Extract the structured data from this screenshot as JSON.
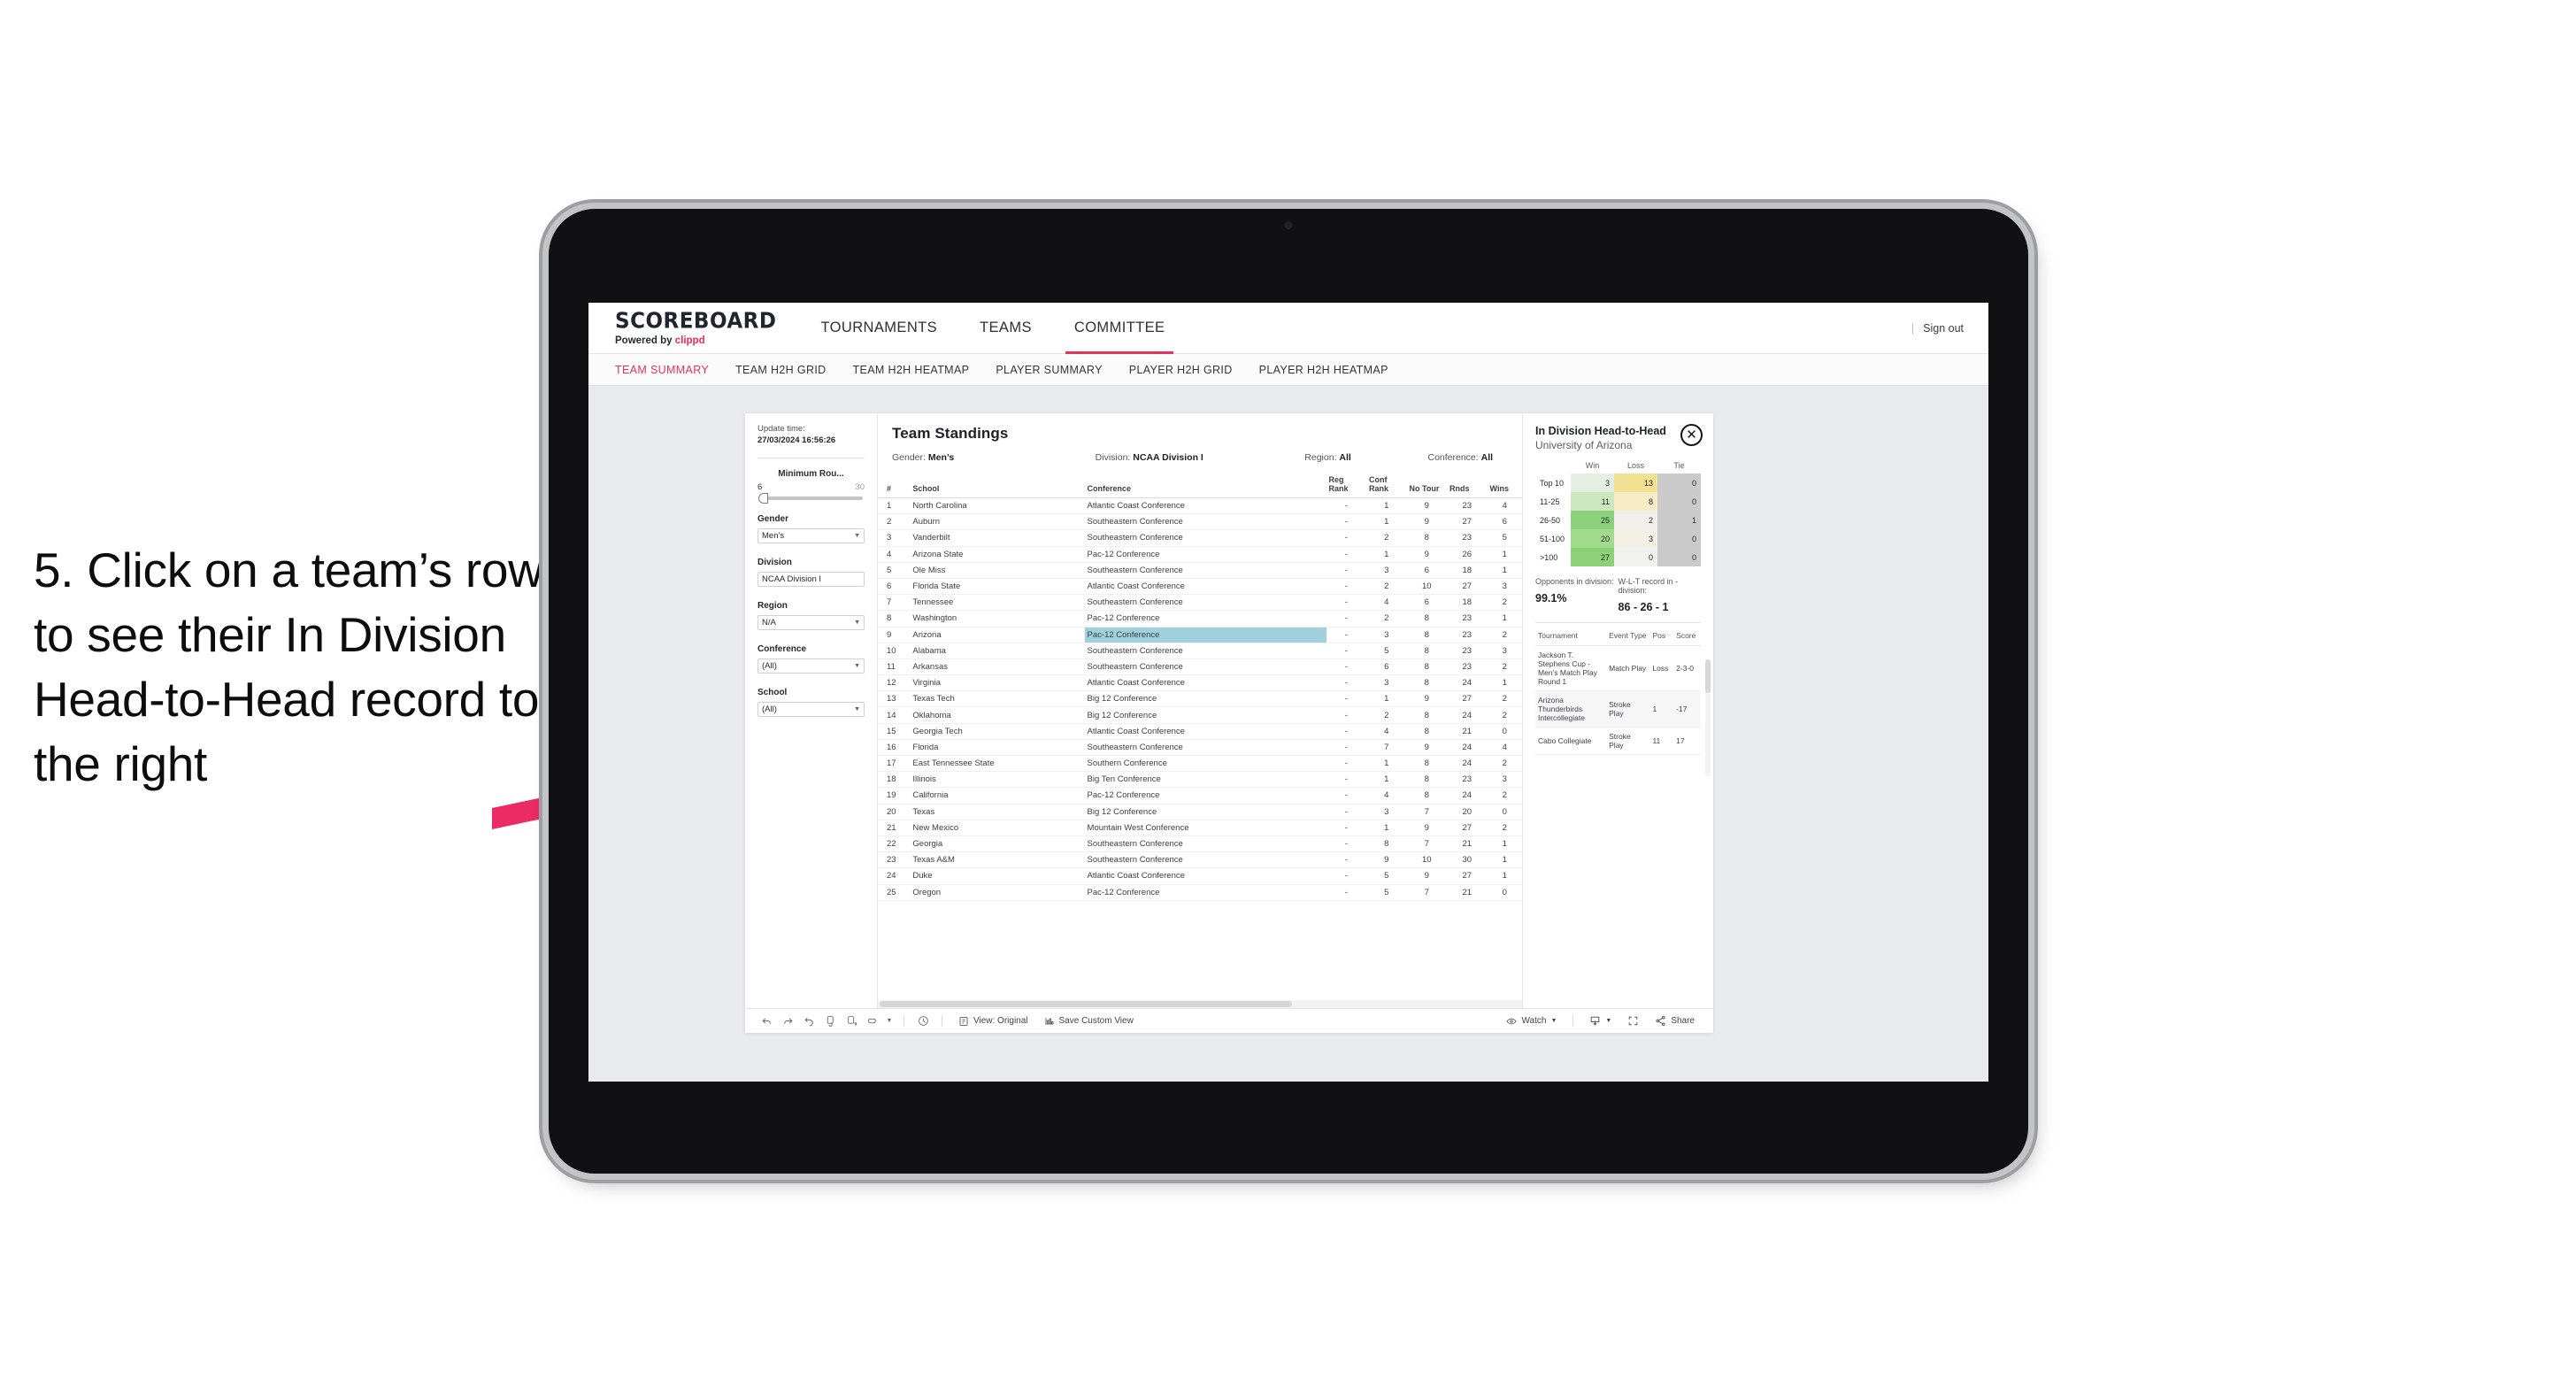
{
  "annotation": {
    "text": "5. Click on a team’s row to see their In Division Head-to-Head record to the right",
    "arrow_color": "#ec2a63"
  },
  "header": {
    "brand_name": "SCOREBOARD",
    "brand_sub_prefix": "Powered by ",
    "brand_sub_accent": "clippd",
    "nav": [
      {
        "label": "TOURNAMENTS",
        "active": false
      },
      {
        "label": "TEAMS",
        "active": false
      },
      {
        "label": "COMMITTEE",
        "active": true
      }
    ],
    "separator": "|",
    "sign_out": "Sign out",
    "accent_color": "#e8315b"
  },
  "subnav": [
    {
      "label": "TEAM SUMMARY",
      "active": true
    },
    {
      "label": "TEAM H2H GRID",
      "active": false
    },
    {
      "label": "TEAM H2H HEATMAP",
      "active": false
    },
    {
      "label": "PLAYER SUMMARY",
      "active": false
    },
    {
      "label": "PLAYER H2H GRID",
      "active": false
    },
    {
      "label": "PLAYER H2H HEATMAP",
      "active": false
    }
  ],
  "sidebar": {
    "update_label": "Update time:",
    "update_value": "27/03/2024 16:56:26",
    "slider": {
      "title": "Minimum Rou...",
      "min": "6",
      "max": "30"
    },
    "filters": [
      {
        "title": "Gender",
        "value": "Men’s"
      },
      {
        "title": "Division",
        "value": "NCAA Division I"
      },
      {
        "title": "Region",
        "value": "N/A"
      },
      {
        "title": "Conference",
        "value": "(All)"
      },
      {
        "title": "School",
        "value": "(All)"
      }
    ]
  },
  "standings": {
    "title": "Team Standings",
    "crumbs": {
      "gender_label": "Gender:",
      "gender_value": "Men’s",
      "division_label": "Division:",
      "division_value": "NCAA Division I",
      "region_label": "Region:",
      "region_value": "All",
      "conference_label": "Conference:",
      "conference_value": "All"
    },
    "columns": [
      "#",
      "School",
      "Conference",
      "Reg Rank",
      "Conf Rank",
      "No Tour",
      "Rnds",
      "Wins"
    ],
    "rows": [
      {
        "n": "1",
        "school": "North Carolina",
        "conf": "Atlantic Coast Conference",
        "reg": "-",
        "cr": "1",
        "nt": "9",
        "rnds": "23",
        "wins": "4",
        "selected": false
      },
      {
        "n": "2",
        "school": "Auburn",
        "conf": "Southeastern Conference",
        "reg": "-",
        "cr": "1",
        "nt": "9",
        "rnds": "27",
        "wins": "6",
        "selected": false
      },
      {
        "n": "3",
        "school": "Vanderbilt",
        "conf": "Southeastern Conference",
        "reg": "-",
        "cr": "2",
        "nt": "8",
        "rnds": "23",
        "wins": "5",
        "selected": false
      },
      {
        "n": "4",
        "school": "Arizona State",
        "conf": "Pac-12 Conference",
        "reg": "-",
        "cr": "1",
        "nt": "9",
        "rnds": "26",
        "wins": "1",
        "selected": false
      },
      {
        "n": "5",
        "school": "Ole Miss",
        "conf": "Southeastern Conference",
        "reg": "-",
        "cr": "3",
        "nt": "6",
        "rnds": "18",
        "wins": "1",
        "selected": false
      },
      {
        "n": "6",
        "school": "Florida State",
        "conf": "Atlantic Coast Conference",
        "reg": "-",
        "cr": "2",
        "nt": "10",
        "rnds": "27",
        "wins": "3",
        "selected": false
      },
      {
        "n": "7",
        "school": "Tennessee",
        "conf": "Southeastern Conference",
        "reg": "-",
        "cr": "4",
        "nt": "6",
        "rnds": "18",
        "wins": "2",
        "selected": false
      },
      {
        "n": "8",
        "school": "Washington",
        "conf": "Pac-12 Conference",
        "reg": "-",
        "cr": "2",
        "nt": "8",
        "rnds": "23",
        "wins": "1",
        "selected": false
      },
      {
        "n": "9",
        "school": "Arizona",
        "conf": "Pac-12 Conference",
        "reg": "-",
        "cr": "3",
        "nt": "8",
        "rnds": "23",
        "wins": "2",
        "selected": true
      },
      {
        "n": "10",
        "school": "Alabama",
        "conf": "Southeastern Conference",
        "reg": "-",
        "cr": "5",
        "nt": "8",
        "rnds": "23",
        "wins": "3",
        "selected": false
      },
      {
        "n": "11",
        "school": "Arkansas",
        "conf": "Southeastern Conference",
        "reg": "-",
        "cr": "6",
        "nt": "8",
        "rnds": "23",
        "wins": "2",
        "selected": false
      },
      {
        "n": "12",
        "school": "Virginia",
        "conf": "Atlantic Coast Conference",
        "reg": "-",
        "cr": "3",
        "nt": "8",
        "rnds": "24",
        "wins": "1",
        "selected": false
      },
      {
        "n": "13",
        "school": "Texas Tech",
        "conf": "Big 12 Conference",
        "reg": "-",
        "cr": "1",
        "nt": "9",
        "rnds": "27",
        "wins": "2",
        "selected": false
      },
      {
        "n": "14",
        "school": "Oklahoma",
        "conf": "Big 12 Conference",
        "reg": "-",
        "cr": "2",
        "nt": "8",
        "rnds": "24",
        "wins": "2",
        "selected": false
      },
      {
        "n": "15",
        "school": "Georgia Tech",
        "conf": "Atlantic Coast Conference",
        "reg": "-",
        "cr": "4",
        "nt": "8",
        "rnds": "21",
        "wins": "0",
        "selected": false
      },
      {
        "n": "16",
        "school": "Florida",
        "conf": "Southeastern Conference",
        "reg": "-",
        "cr": "7",
        "nt": "9",
        "rnds": "24",
        "wins": "4",
        "selected": false
      },
      {
        "n": "17",
        "school": "East Tennessee State",
        "conf": "Southern Conference",
        "reg": "-",
        "cr": "1",
        "nt": "8",
        "rnds": "24",
        "wins": "2",
        "selected": false
      },
      {
        "n": "18",
        "school": "Illinois",
        "conf": "Big Ten Conference",
        "reg": "-",
        "cr": "1",
        "nt": "8",
        "rnds": "23",
        "wins": "3",
        "selected": false
      },
      {
        "n": "19",
        "school": "California",
        "conf": "Pac-12 Conference",
        "reg": "-",
        "cr": "4",
        "nt": "8",
        "rnds": "24",
        "wins": "2",
        "selected": false
      },
      {
        "n": "20",
        "school": "Texas",
        "conf": "Big 12 Conference",
        "reg": "-",
        "cr": "3",
        "nt": "7",
        "rnds": "20",
        "wins": "0",
        "selected": false
      },
      {
        "n": "21",
        "school": "New Mexico",
        "conf": "Mountain West Conference",
        "reg": "-",
        "cr": "1",
        "nt": "9",
        "rnds": "27",
        "wins": "2",
        "selected": false
      },
      {
        "n": "22",
        "school": "Georgia",
        "conf": "Southeastern Conference",
        "reg": "-",
        "cr": "8",
        "nt": "7",
        "rnds": "21",
        "wins": "1",
        "selected": false
      },
      {
        "n": "23",
        "school": "Texas A&M",
        "conf": "Southeastern Conference",
        "reg": "-",
        "cr": "9",
        "nt": "10",
        "rnds": "30",
        "wins": "1",
        "selected": false
      },
      {
        "n": "24",
        "school": "Duke",
        "conf": "Atlantic Coast Conference",
        "reg": "-",
        "cr": "5",
        "nt": "9",
        "rnds": "27",
        "wins": "1",
        "selected": false
      },
      {
        "n": "25",
        "school": "Oregon",
        "conf": "Pac-12 Conference",
        "reg": "-",
        "cr": "5",
        "nt": "7",
        "rnds": "21",
        "wins": "0",
        "selected": false
      }
    ]
  },
  "h2h": {
    "title": "In Division Head-to-Head",
    "subtitle": "University of Arizona",
    "close_icon": "close-icon",
    "stats": {
      "opponents_label": "Opponents in division:",
      "opponents_value": "99.1%",
      "record_label": "W-L-T record in -division:",
      "record_value": "86 - 26 - 1"
    },
    "tournament_columns": [
      "Tournament",
      "Event Type",
      "Pos",
      "Score"
    ],
    "tournaments": [
      {
        "name": "Jackson T. Stephens Cup - Men’s Match Play Round 1",
        "type": "Match Play",
        "pos": "Loss",
        "score": "2-3-0"
      },
      {
        "name": "Arizona Thunderbirds Intercollegiate",
        "type": "Stroke Play",
        "pos": "1",
        "score": "-17"
      },
      {
        "name": "Cabo Collegiate",
        "type": "Stroke Play",
        "pos": "11",
        "score": "17"
      }
    ]
  },
  "chart_data": {
    "type": "heatmap",
    "title": "In Division Head-to-Head",
    "subtitle": "University of Arizona",
    "columns": [
      "Win",
      "Loss",
      "Tie"
    ],
    "categories": [
      "Top 10",
      "11-25",
      "26-50",
      "51-100",
      ">100"
    ],
    "series": [
      {
        "name": "Win",
        "values": [
          3,
          11,
          25,
          20,
          27
        ]
      },
      {
        "name": "Loss",
        "values": [
          13,
          8,
          2,
          3,
          0
        ]
      },
      {
        "name": "Tie",
        "values": [
          0,
          0,
          1,
          0,
          0
        ]
      }
    ],
    "cell_colors": {
      "win": [
        "#e4efe1",
        "#cbe7bf",
        "#8bd07a",
        "#a2da8c",
        "#8cd178"
      ],
      "loss": [
        "#f2e193",
        "#f7ecc5",
        "#f0efea",
        "#f3efe4",
        "#f1f1ef"
      ],
      "tie": [
        "#cacaca",
        "#cacaca",
        "#cacaca",
        "#cacaca",
        "#cacaca"
      ]
    },
    "grid": false,
    "legend": "none"
  },
  "toolbar": {
    "icons": [
      "undo-icon",
      "redo-icon",
      "revert-icon",
      "refresh-data-icon",
      "pause-auto-update-icon",
      "device-layout-icon"
    ],
    "clock_icon": "history-icon",
    "view_label": "View: Original",
    "view_icon": "view-icon",
    "save_label": "Save Custom View",
    "save_icon": "save-view-icon",
    "watch_label": "Watch",
    "watch_icon": "eye-icon",
    "download_icon": "download-icon",
    "fullscreen_icon": "fullscreen-icon",
    "share_label": "Share",
    "share_icon": "share-icon"
  }
}
